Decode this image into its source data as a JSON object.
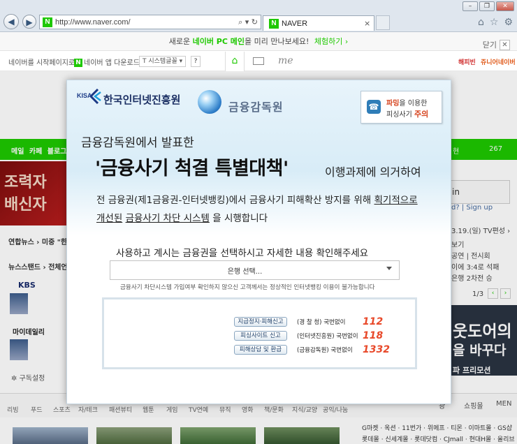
{
  "browser": {
    "address_url": "http://www.naver.com/",
    "address_tools": "⌕ ▾ ↻",
    "tab_title": "NAVER",
    "tab_close": "×",
    "win_min": "–",
    "win_max": "❐",
    "win_close": "✕"
  },
  "promo": {
    "prefix": "새로운 ",
    "highlight": "네이버 PC 메인",
    "suffix": "을 미리 만나보세요!",
    "link": "체험하기 ›",
    "close_label": "닫기",
    "close_x": "✕"
  },
  "toolbar": {
    "start_page": "네이버를 시작페이지로 ›",
    "app_download": "네이버 앱 다운로드",
    "font_label": "T 시스템글꼴 ▾",
    "help": "?",
    "me": "me",
    "right1": "해피빈",
    "right2": "쥬니어네이버"
  },
  "greenbar": {
    "menu": "메일 카페 블로그",
    "r1": "현",
    "r2": "267"
  },
  "left": {
    "banner_l1": "조력자",
    "banner_l2": "배신자",
    "yonhap": "연합뉴스 ›  미중 \"한",
    "newsstand": "뉴스스탠드 ›  전체언",
    "kbs": "KBS",
    "mydaily": "마이데일리",
    "subscribe": "✲ 구독설정"
  },
  "right": {
    "login": "in",
    "links": "d? | Sign up",
    "date": "3.19.(일)  TV편성 ›",
    "l1": "보기",
    "l2": "공연 | 전시회",
    "l3": "이에 3:4로 석패",
    "l4": "은행 2차전 승",
    "page": "1/3",
    "prev": "‹",
    "next": "›",
    "ad1": "웃도어의",
    "ad2": "을 바꾸다",
    "ad3": "파 프리모션"
  },
  "bottom": {
    "tabs": [
      "리빙",
      "푸드",
      "스포츠",
      "자/테크",
      "패션뷰티",
      "웹툰",
      "게임",
      "TV연예",
      "뮤직",
      "영화",
      "책/문화",
      "지식/교양",
      "공익/나눔"
    ],
    "shop_tab1": "광",
    "shop_tab2": "쇼핑몰",
    "shop_tab3": "MEN",
    "shop_line1": "G마켓 · 옥션 · 11번가 · 위메프 · 티몬 · 이마트몰 · GS샵",
    "shop_line2": "롯데몰 · 신세계몰 · 롯데닷컴 · CJmall · 현대H몰 · 올리브영"
  },
  "modal": {
    "kisa_abbr": "KISA",
    "kisa_name": "한국인터넷진흥원",
    "fss_name": "금융감독원",
    "warn_l1_hl": "파밍",
    "warn_l1_rest": "을 이용한",
    "warn_l2_pre": "피싱사기 ",
    "warn_l2_hl": "주의",
    "subtitle": "금융감독원에서 발표한",
    "title": "'금융사기 척결 특별대책'",
    "title_tail": "이행과제에 의거하여",
    "p1": "전 금융권(제1금융권-인터넷뱅킹)에서 금융사기 피해확산 방지를 위해 ",
    "p1_ul": "획기적으로",
    "p2_ul1": "개선된",
    "p2_mid": " ",
    "p2_ul2": "금융사기 차단 시스템",
    "p2_tail": " 을 시행합니다",
    "instruction": "사용하고 계시는 금융권을 선택하시고 자세한 내용 확인해주세요",
    "select_value": "은행 선택...",
    "note": "금융사기 차단시스템 가입여부  확인하지 않으신 고객께서는 정상적인 인터넷뱅킹 이용이 불가능합니다",
    "contacts": [
      {
        "label": "지급정지·피해신고",
        "org": "(경   찰   청) 국번없이",
        "num": "112"
      },
      {
        "label": "피싱사이트 신고",
        "org": "(인터넷진흥원) 국번없이",
        "num": "118"
      },
      {
        "label": "피해상담 및 환급",
        "org": "(금융감독원) 국번없이",
        "num": "1332"
      }
    ]
  }
}
